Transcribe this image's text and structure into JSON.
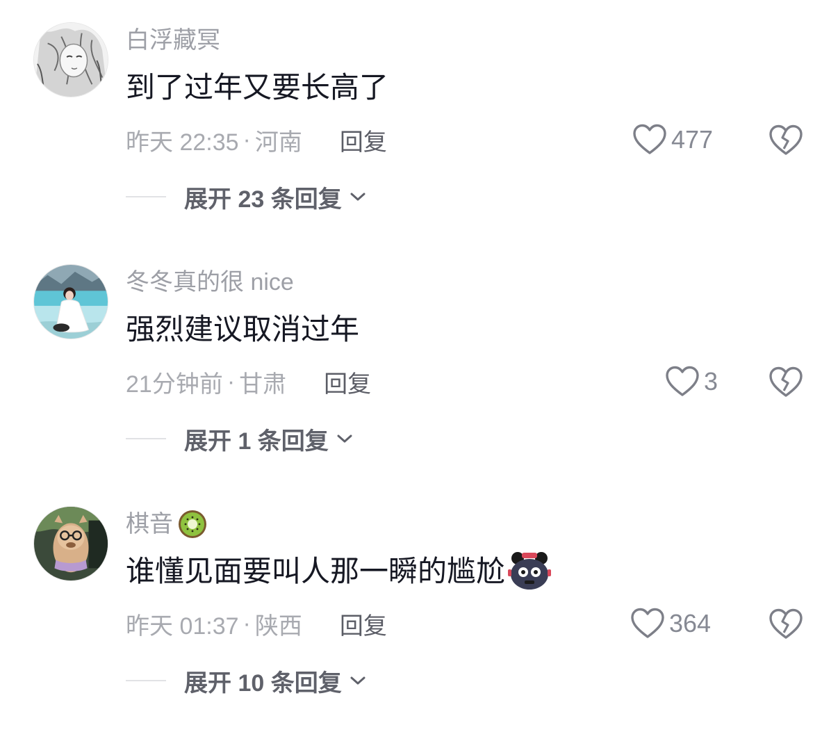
{
  "comments": [
    {
      "username": "白浮藏冥",
      "text": "到了过年又要长高了",
      "time": "昨天 22:35",
      "separator": "·",
      "location": "河南",
      "reply_label": "回复",
      "likes": "477",
      "expand_label": "展开 23 条回复",
      "avatar_icon": "anime-sketch-avatar"
    },
    {
      "username": "冬冬真的很 nice",
      "text": "强烈建议取消过年",
      "time": "21分钟前",
      "separator": "·",
      "location": "甘肃",
      "reply_label": "回复",
      "likes": "3",
      "expand_label": "展开 1 条回复",
      "avatar_icon": "beach-photo-avatar"
    },
    {
      "username": "棋音",
      "username_emoji": "kiwi-icon",
      "text": "谁懂见面要叫人那一瞬的尴尬",
      "text_emoji": "awkward-face-icon",
      "time": "昨天 01:37",
      "separator": "·",
      "location": "陕西",
      "reply_label": "回复",
      "likes": "364",
      "expand_label": "展开 10 条回复",
      "avatar_icon": "alpaca-photo-avatar"
    }
  ],
  "colors": {
    "username": "#9d9fa6",
    "comment_text": "#161823",
    "meta": "#a8aab0",
    "reply": "#5b5d66",
    "expand": "#5f616a"
  }
}
